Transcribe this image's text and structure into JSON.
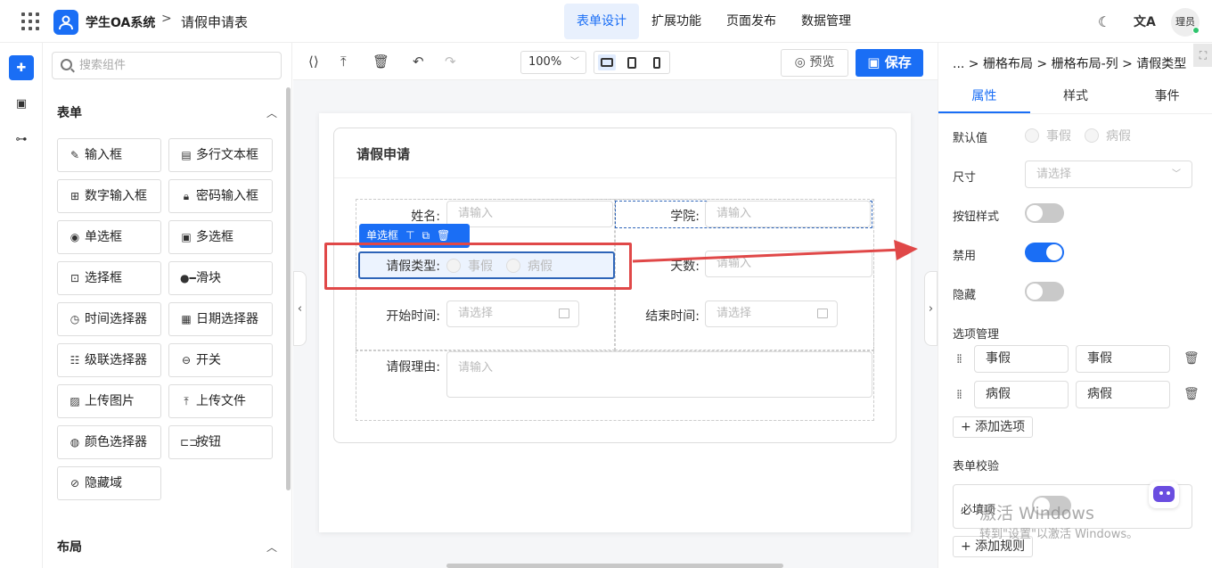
{
  "header": {
    "app_title": "学生OA系统",
    "separator": ">",
    "page_name": "请假申请表",
    "nav": [
      "表单设计",
      "扩展功能",
      "页面发布",
      "数据管理"
    ],
    "user": "理员"
  },
  "palette": {
    "search_placeholder": "搜索组件",
    "form_section": "表单",
    "layout_section": "布局",
    "components": [
      "输入框",
      "多行文本框",
      "数字输入框",
      "密码输入框",
      "单选框",
      "多选框",
      "选择框",
      "滑块",
      "时间选择器",
      "日期选择器",
      "级联选择器",
      "开关",
      "上传图片",
      "上传文件",
      "颜色选择器",
      "按钮",
      "隐藏域"
    ]
  },
  "toolbar": {
    "zoom": "100%",
    "preview": "预览",
    "save": "保存"
  },
  "canvas": {
    "card_title": "请假申请",
    "fields": {
      "name_label": "姓名:",
      "name_placeholder": "请输入",
      "college_label": "学院:",
      "college_placeholder": "请输入",
      "type_label": "请假类型:",
      "type_options": [
        "事假",
        "病假"
      ],
      "days_label": "天数:",
      "days_placeholder": "请输入",
      "start_label": "开始时间:",
      "start_placeholder": "请选择",
      "end_label": "结束时间:",
      "end_placeholder": "请选择",
      "reason_label": "请假理由:",
      "reason_placeholder": "请输入"
    },
    "selected_tag": "单选框"
  },
  "props": {
    "breadcrumb": "... > 栅格布局 > 栅格布局-列 > 请假类型",
    "tabs": [
      "属性",
      "样式",
      "事件"
    ],
    "default_label": "默认值",
    "default_options": [
      "事假",
      "病假"
    ],
    "size_label": "尺寸",
    "size_placeholder": "请选择",
    "button_style_label": "按钮样式",
    "button_style_on": false,
    "disabled_label": "禁用",
    "disabled_on": true,
    "hidden_label": "隐藏",
    "hidden_on": false,
    "options_label": "选项管理",
    "options": [
      {
        "label": "事假",
        "value": "事假"
      },
      {
        "label": "病假",
        "value": "病假"
      }
    ],
    "add_option": "+ 添加选项",
    "validation_label": "表单校验",
    "required_label": "必填项",
    "add_rule": "+ 添加规则"
  },
  "watermark": {
    "line1": "激活 Windows",
    "line2": "转到\"设置\"以激活 Windows。"
  },
  "colors": {
    "accent": "#1a6ef5",
    "annotation_red": "#e04848"
  }
}
